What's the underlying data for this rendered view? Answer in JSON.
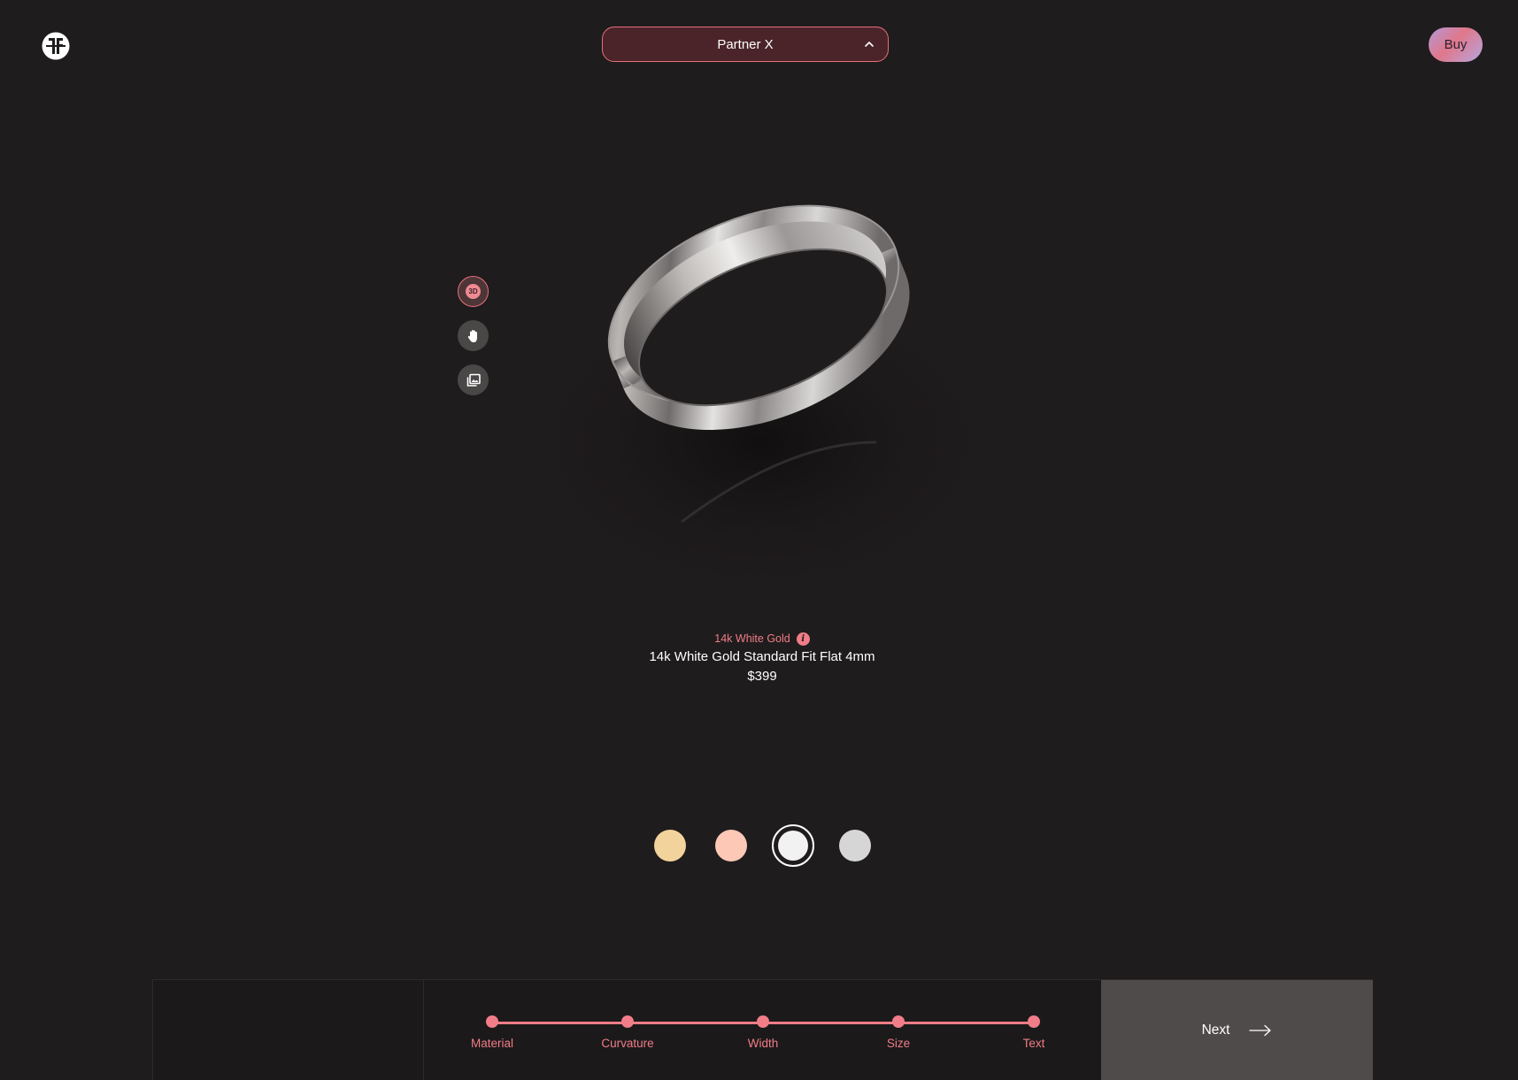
{
  "header": {
    "partner_select": {
      "value": "Partner X"
    },
    "buy_label": "Buy"
  },
  "view_tools": [
    {
      "name": "3d-view",
      "label": "3D",
      "active": true
    },
    {
      "name": "hand-rotate",
      "active": false
    },
    {
      "name": "gallery",
      "active": false
    }
  ],
  "product": {
    "material": "14k White Gold",
    "name": "14k White Gold Standard Fit Flat 4mm",
    "price": "$399"
  },
  "swatches": [
    {
      "name": "yellow-gold",
      "color": "#f3d39c",
      "selected": false
    },
    {
      "name": "rose-gold",
      "color": "#fdc8b6",
      "selected": false
    },
    {
      "name": "white-gold",
      "color": "#f2f2f2",
      "selected": true
    },
    {
      "name": "platinum",
      "color": "#d6d6d6",
      "selected": false
    }
  ],
  "stepper": {
    "steps": [
      "Material",
      "Curvature",
      "Width",
      "Size",
      "Text"
    ]
  },
  "next_label": "Next",
  "colors": {
    "accent": "#f07d88",
    "background": "#1f1c1d",
    "next_button": "#4f4b4a"
  }
}
